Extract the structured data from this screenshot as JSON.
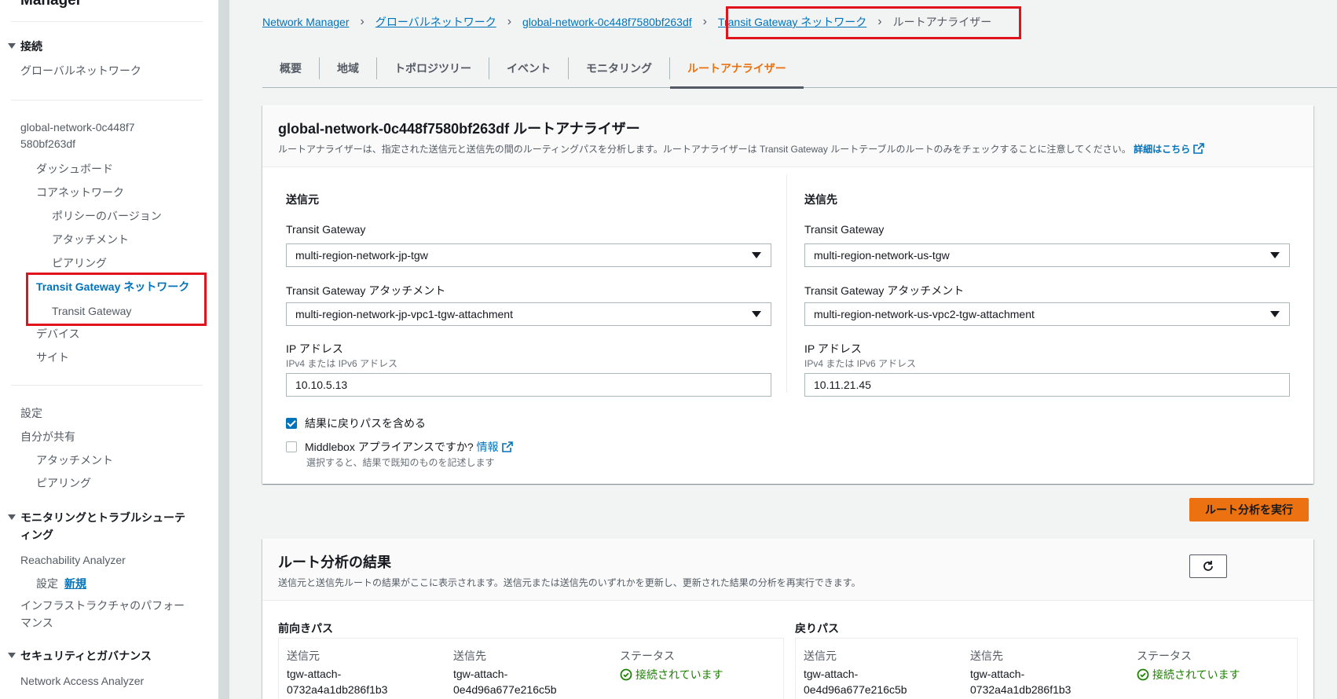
{
  "sidebar": {
    "title": "Manager",
    "sections": {
      "connect": "接続",
      "monitoring": "モニタリングとトラブルシューティング",
      "security": "セキュリティとガバナンス"
    },
    "items": {
      "global_networks": "グローバルネットワーク",
      "network_id": "global-network-0c448f7580bf263df",
      "dashboard": "ダッシュボード",
      "core_network": "コアネットワーク",
      "policy_versions": "ポリシーのバージョン",
      "attachments": "アタッチメント",
      "peering": "ピアリング",
      "tgw_network": "Transit Gateway ネットワーク",
      "transit_gateway": "Transit Gateway",
      "devices": "デバイス",
      "sites": "サイト",
      "settings": "設定",
      "shared_with_me": "自分が共有",
      "shared_attachments": "アタッチメント",
      "shared_peering": "ピアリング",
      "reachability_analyzer": "Reachability Analyzer",
      "ra_settings": "設定",
      "ra_new_badge": "新規",
      "infra_performance": "インフラストラクチャのパフォーマンス",
      "network_access_analyzer": "Network Access Analyzer"
    }
  },
  "breadcrumb": {
    "items": [
      "Network Manager",
      "グローバルネットワーク",
      "global-network-0c448f7580bf263df",
      "Transit Gateway ネットワーク"
    ],
    "current": "ルートアナライザー"
  },
  "tabs": [
    "概要",
    "地域",
    "トポロジツリー",
    "イベント",
    "モニタリング",
    "ルートアナライザー"
  ],
  "analyzer": {
    "title": "global-network-0c448f7580bf263df ルートアナライザー",
    "description": "ルートアナライザーは、指定された送信元と送信先の間のルーティングパスを分析します。ルートアナライザーは Transit Gateway ルートテーブルのルートのみをチェックすることに注意してください。",
    "learn_more": "詳細はこちら",
    "source": {
      "title": "送信元",
      "tgw_label": "Transit Gateway",
      "tgw_value": "multi-region-network-jp-tgw",
      "attachment_label": "Transit Gateway アタッチメント",
      "attachment_value": "multi-region-network-jp-vpc1-tgw-attachment",
      "ip_label": "IP アドレス",
      "ip_desc": "IPv4 または IPv6 アドレス",
      "ip_value": "10.10.5.13"
    },
    "destination": {
      "title": "送信先",
      "tgw_label": "Transit Gateway",
      "tgw_value": "multi-region-network-us-tgw",
      "attachment_label": "Transit Gateway アタッチメント",
      "attachment_value": "multi-region-network-us-vpc2-tgw-attachment",
      "ip_label": "IP アドレス",
      "ip_desc": "IPv4 または IPv6 アドレス",
      "ip_value": "10.11.21.45"
    },
    "include_return_label": "結果に戻りパスを含める",
    "include_return_checked": true,
    "middlebox_label": "Middlebox アプライアンスですか?",
    "middlebox_info": "情報",
    "middlebox_desc": "選択すると、結果で既知のものを記述します",
    "middlebox_checked": false,
    "run_button": "ルート分析を実行"
  },
  "results": {
    "title": "ルート分析の結果",
    "description": "送信元と送信先ルートの結果がここに表示されます。送信元または送信先のいずれかを更新し、更新された結果の分析を再実行できます。",
    "forward": {
      "title": "前向きパス",
      "source_label": "送信元",
      "source_value_1": "tgw-attach-",
      "source_value_2": "0732a4a1db286f1b3",
      "dest_label": "送信先",
      "dest_value_1": "tgw-attach-",
      "dest_value_2": "0e4d96a677e216c5b",
      "status_label": "ステータス",
      "status_value": "接続されています"
    },
    "return": {
      "title": "戻りパス",
      "source_label": "送信元",
      "source_value_1": "tgw-attach-",
      "source_value_2": "0e4d96a677e216c5b",
      "dest_label": "送信先",
      "dest_value_1": "tgw-attach-",
      "dest_value_2": "0732a4a1db286f1b3",
      "status_label": "ステータス",
      "status_value": "接続されています"
    }
  },
  "colors": {
    "link": "#0073bb",
    "accent": "#ec7211",
    "highlight": "#e1141e",
    "success": "#1d8102"
  }
}
